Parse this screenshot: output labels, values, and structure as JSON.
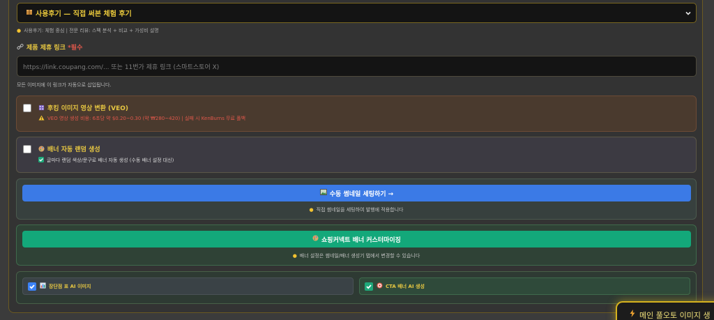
{
  "review_type": {
    "selected": "사용후기 — 직접 써본 체험 후기",
    "hint": "사용후기: 체험 중심 | 전문 리뷰: 스펙 분석 + 비교 + 가성비 설명"
  },
  "affiliate_link": {
    "label": "제품 제휴 링크",
    "required": "*필수",
    "placeholder": "https://link.coupang.com/... 또는 11번가 제휴 링크 (스마트스토어 X)",
    "note": "모든 이미지에 이 링크가 자동으로 삽입됩니다."
  },
  "veo_option": {
    "title": "후킹 이미지 영상 변환 (VEO)",
    "warning": "VEO 영상 생성 비용: 6초당 약 $0.20~0.30 (약 ₩280~420) | 실패 시 KenBurns 무료 폴백",
    "checked": false
  },
  "banner_option": {
    "title": "배너 자동 랜덤 생성",
    "sub": "글마다 랜덤 색상/문구로 배너 자동 생성 (수동 배너 설정 대신)",
    "checked": false
  },
  "thumbnail": {
    "button": "수동 썸네일 세팅하기 →",
    "hint": "직접 썸네일을 세팅하여 발행에 적용합니다"
  },
  "shortcut_banner": {
    "button": "쇼핑커넥트 배너 커스터마이징",
    "hint": "배너 설정은 썸네일/배너 생성기 탭에서 변경할 수 있습니다"
  },
  "ai_options": {
    "pros_cons": {
      "label": "장단점 표 AI 이미지",
      "checked": true
    },
    "cta_banner": {
      "label": "CTA 배너 AI 생성",
      "checked": true
    }
  },
  "floating_button": {
    "label": "메인 풀오토 이미지 생"
  },
  "colors": {
    "accent_gold": "#e7c742",
    "primary_blue": "#3b7ae6",
    "primary_green": "#13a87a",
    "danger_red": "#e0584b"
  }
}
